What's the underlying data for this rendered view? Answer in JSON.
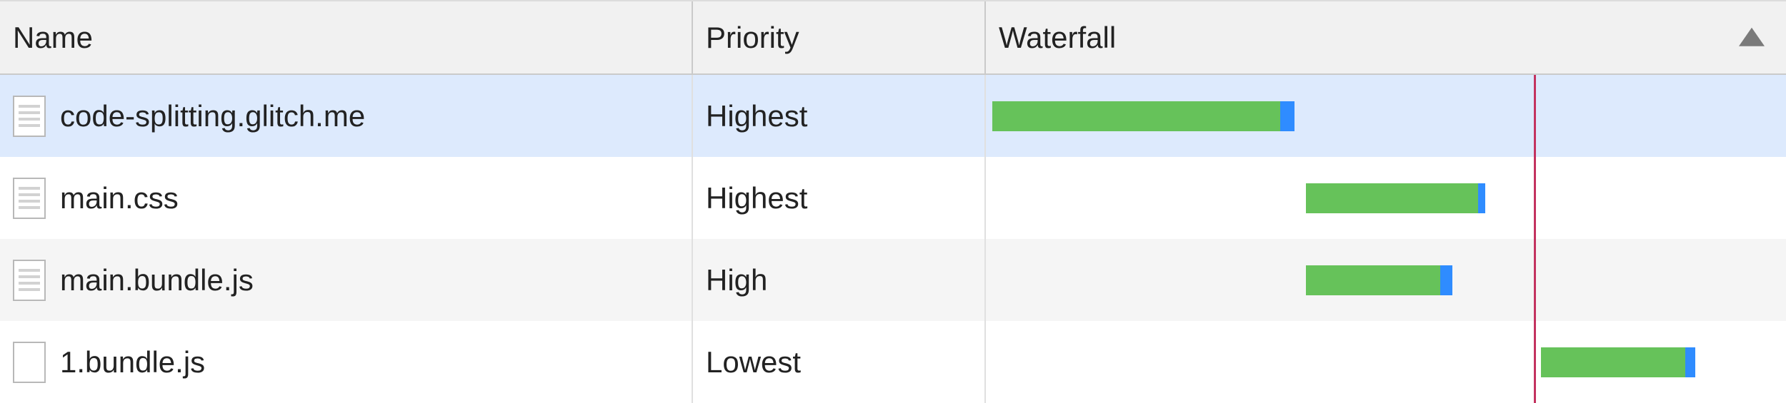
{
  "columns": {
    "name": "Name",
    "priority": "Priority",
    "waterfall": "Waterfall"
  },
  "sort": {
    "column": "waterfall",
    "direction": "asc"
  },
  "event_marker_pct": 68.5,
  "rows": [
    {
      "name": "code-splitting.glitch.me",
      "priority": "Highest",
      "icon": "document",
      "selected": true,
      "bar": {
        "start_pct": 0.8,
        "wait_pct": 36.0,
        "download_pct": 1.8
      }
    },
    {
      "name": "main.css",
      "priority": "Highest",
      "icon": "document",
      "selected": false,
      "bar": {
        "start_pct": 40.0,
        "wait_pct": 21.5,
        "download_pct": 0.9
      }
    },
    {
      "name": "main.bundle.js",
      "priority": "High",
      "icon": "document",
      "selected": false,
      "bar": {
        "start_pct": 40.0,
        "wait_pct": 16.8,
        "download_pct": 1.5
      }
    },
    {
      "name": "1.bundle.js",
      "priority": "Lowest",
      "icon": "blank",
      "selected": false,
      "bar": {
        "start_pct": 69.4,
        "wait_pct": 18.0,
        "download_pct": 1.3
      }
    }
  ]
}
